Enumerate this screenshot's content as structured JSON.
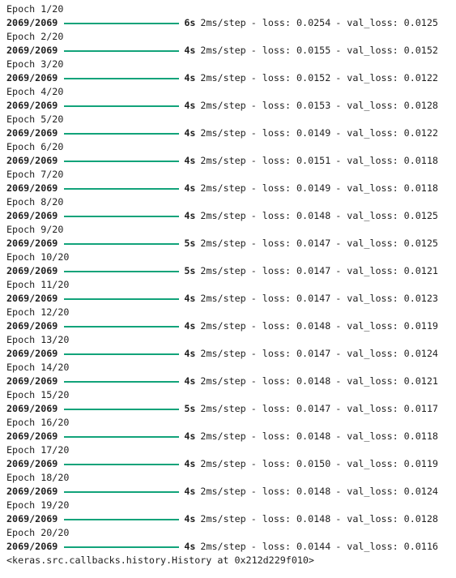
{
  "colors": {
    "progress_bar": "#12a37a",
    "text": "#212121",
    "background": "#ffffff"
  },
  "epochs": [
    {
      "header": "Epoch 1/20",
      "steps": "2069/2069",
      "progress": 1.0,
      "time": "6s",
      "rate": "2ms/step",
      "loss": "- loss: 0.0254",
      "val_loss": "- val_loss: 0.0125"
    },
    {
      "header": "Epoch 2/20",
      "steps": "2069/2069",
      "progress": 1.0,
      "time": "4s",
      "rate": "2ms/step",
      "loss": "- loss: 0.0155",
      "val_loss": "- val_loss: 0.0152"
    },
    {
      "header": "Epoch 3/20",
      "steps": "2069/2069",
      "progress": 1.0,
      "time": "4s",
      "rate": "2ms/step",
      "loss": "- loss: 0.0152",
      "val_loss": "- val_loss: 0.0122"
    },
    {
      "header": "Epoch 4/20",
      "steps": "2069/2069",
      "progress": 1.0,
      "time": "4s",
      "rate": "2ms/step",
      "loss": "- loss: 0.0153",
      "val_loss": "- val_loss: 0.0128"
    },
    {
      "header": "Epoch 5/20",
      "steps": "2069/2069",
      "progress": 1.0,
      "time": "4s",
      "rate": "2ms/step",
      "loss": "- loss: 0.0149",
      "val_loss": "- val_loss: 0.0122"
    },
    {
      "header": "Epoch 6/20",
      "steps": "2069/2069",
      "progress": 1.0,
      "time": "4s",
      "rate": "2ms/step",
      "loss": "- loss: 0.0151",
      "val_loss": "- val_loss: 0.0118"
    },
    {
      "header": "Epoch 7/20",
      "steps": "2069/2069",
      "progress": 1.0,
      "time": "4s",
      "rate": "2ms/step",
      "loss": "- loss: 0.0149",
      "val_loss": "- val_loss: 0.0118"
    },
    {
      "header": "Epoch 8/20",
      "steps": "2069/2069",
      "progress": 1.0,
      "time": "4s",
      "rate": "2ms/step",
      "loss": "- loss: 0.0148",
      "val_loss": "- val_loss: 0.0125"
    },
    {
      "header": "Epoch 9/20",
      "steps": "2069/2069",
      "progress": 1.0,
      "time": "5s",
      "rate": "2ms/step",
      "loss": "- loss: 0.0147",
      "val_loss": "- val_loss: 0.0125"
    },
    {
      "header": "Epoch 10/20",
      "steps": "2069/2069",
      "progress": 1.0,
      "time": "5s",
      "rate": "2ms/step",
      "loss": "- loss: 0.0147",
      "val_loss": "- val_loss: 0.0121"
    },
    {
      "header": "Epoch 11/20",
      "steps": "2069/2069",
      "progress": 1.0,
      "time": "4s",
      "rate": "2ms/step",
      "loss": "- loss: 0.0147",
      "val_loss": "- val_loss: 0.0123"
    },
    {
      "header": "Epoch 12/20",
      "steps": "2069/2069",
      "progress": 1.0,
      "time": "4s",
      "rate": "2ms/step",
      "loss": "- loss: 0.0148",
      "val_loss": "- val_loss: 0.0119"
    },
    {
      "header": "Epoch 13/20",
      "steps": "2069/2069",
      "progress": 1.0,
      "time": "4s",
      "rate": "2ms/step",
      "loss": "- loss: 0.0147",
      "val_loss": "- val_loss: 0.0124"
    },
    {
      "header": "Epoch 14/20",
      "steps": "2069/2069",
      "progress": 1.0,
      "time": "4s",
      "rate": "2ms/step",
      "loss": "- loss: 0.0148",
      "val_loss": "- val_loss: 0.0121"
    },
    {
      "header": "Epoch 15/20",
      "steps": "2069/2069",
      "progress": 1.0,
      "time": "5s",
      "rate": "2ms/step",
      "loss": "- loss: 0.0147",
      "val_loss": "- val_loss: 0.0117"
    },
    {
      "header": "Epoch 16/20",
      "steps": "2069/2069",
      "progress": 1.0,
      "time": "4s",
      "rate": "2ms/step",
      "loss": "- loss: 0.0148",
      "val_loss": "- val_loss: 0.0118"
    },
    {
      "header": "Epoch 17/20",
      "steps": "2069/2069",
      "progress": 1.0,
      "time": "4s",
      "rate": "2ms/step",
      "loss": "- loss: 0.0150",
      "val_loss": "- val_loss: 0.0119"
    },
    {
      "header": "Epoch 18/20",
      "steps": "2069/2069",
      "progress": 1.0,
      "time": "4s",
      "rate": "2ms/step",
      "loss": "- loss: 0.0148",
      "val_loss": "- val_loss: 0.0124"
    },
    {
      "header": "Epoch 19/20",
      "steps": "2069/2069",
      "progress": 1.0,
      "time": "4s",
      "rate": "2ms/step",
      "loss": "- loss: 0.0148",
      "val_loss": "- val_loss: 0.0128"
    },
    {
      "header": "Epoch 20/20",
      "steps": "2069/2069",
      "progress": 1.0,
      "time": "4s",
      "rate": "2ms/step",
      "loss": "- loss: 0.0144",
      "val_loss": "- val_loss: 0.0116"
    }
  ],
  "result": "<keras.src.callbacks.history.History at 0x212d229f010>"
}
